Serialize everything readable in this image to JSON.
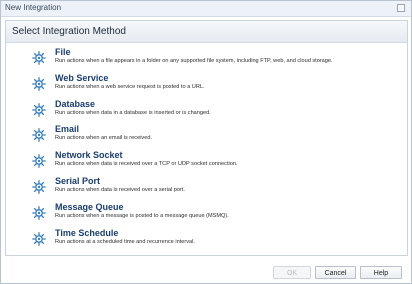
{
  "window": {
    "title": "New Integration"
  },
  "panel": {
    "title": "Select Integration Method"
  },
  "methods": [
    {
      "name": "File",
      "description": "Run actions when a file appears in a folder on any supported file system, including FTP, web, and cloud storage.",
      "icon": "gear-icon"
    },
    {
      "name": "Web Service",
      "description": "Run actions when a web service request is posted to a URL.",
      "icon": "gear-icon"
    },
    {
      "name": "Database",
      "description": "Run actions when data in a database is inserted or is changed.",
      "icon": "gear-icon"
    },
    {
      "name": "Email",
      "description": "Run actions when an email is received.",
      "icon": "gear-icon"
    },
    {
      "name": "Network Socket",
      "description": "Run actions when data is received over a TCP or UDP socket connection.",
      "icon": "gear-icon"
    },
    {
      "name": "Serial Port",
      "description": "Run actions when data is received over a serial port.",
      "icon": "gear-icon"
    },
    {
      "name": "Message Queue",
      "description": "Run actions when a message is posted to a message queue (MSMQ).",
      "icon": "gear-icon"
    },
    {
      "name": "Time Schedule",
      "description": "Run actions at a scheduled time and recurrence interval.",
      "icon": "gear-icon"
    }
  ],
  "buttons": {
    "ok": "OK",
    "cancel": "Cancel",
    "help": "Help"
  },
  "colors": {
    "accent": "#1a3e6f",
    "icon": "#3a7fc1"
  }
}
